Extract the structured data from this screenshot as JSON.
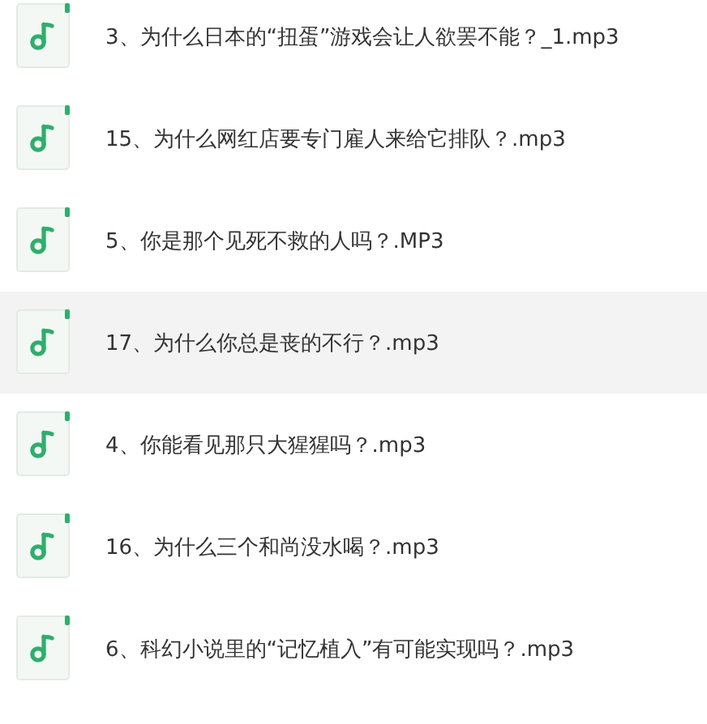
{
  "files": [
    {
      "name": "3、为什么日本的“扭蛋”游戏会让人欲罢不能？_1.mp3",
      "selected": false
    },
    {
      "name": "15、为什么网红店要专门雇人来给它排队？.mp3",
      "selected": false
    },
    {
      "name": "5、你是那个见死不救的人吗？.MP3",
      "selected": false
    },
    {
      "name": "17、为什么你总是丧的不行？.mp3",
      "selected": true
    },
    {
      "name": "4、你能看见那只大猩猩吗？.mp3",
      "selected": false
    },
    {
      "name": "16、为什么三个和尚没水喝？.mp3",
      "selected": false
    },
    {
      "name": "6、科幻小说里的“记忆植入”有可能实现吗？.mp3",
      "selected": false
    }
  ]
}
